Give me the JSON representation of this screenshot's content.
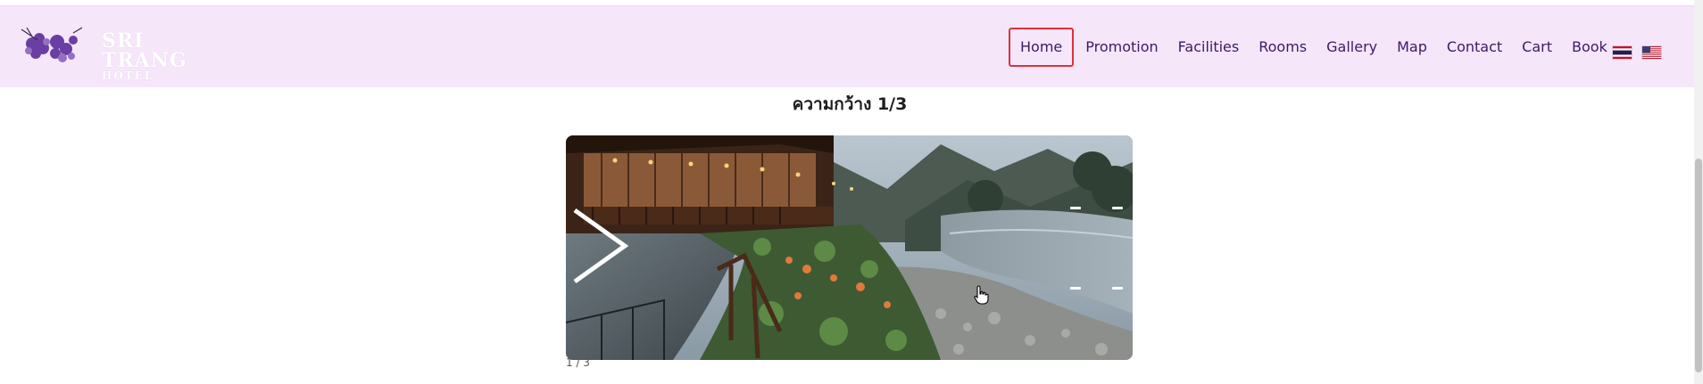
{
  "header": {
    "logo": {
      "title": "SRI TRANG",
      "subtitle": "HOTEL"
    },
    "nav": [
      {
        "label": "Home",
        "active": true
      },
      {
        "label": "Promotion",
        "active": false
      },
      {
        "label": "Facilities",
        "active": false
      },
      {
        "label": "Rooms",
        "active": false
      },
      {
        "label": "Gallery",
        "active": false
      },
      {
        "label": "Map",
        "active": false
      },
      {
        "label": "Contact",
        "active": false
      },
      {
        "label": "Cart",
        "active": false
      },
      {
        "label": "Book",
        "active": false
      }
    ],
    "languages": [
      {
        "icon": "thai-flag-icon"
      },
      {
        "icon": "us-flag-icon"
      }
    ]
  },
  "main": {
    "caption": "ความกว้าง 1/3",
    "slider": {
      "next_icon": "chevron-right-icon",
      "counter": "1 / 3"
    }
  },
  "colors": {
    "navbar_bg": "#f6e6fa",
    "nav_text": "#3d1a63",
    "active_border": "#e0303c"
  }
}
